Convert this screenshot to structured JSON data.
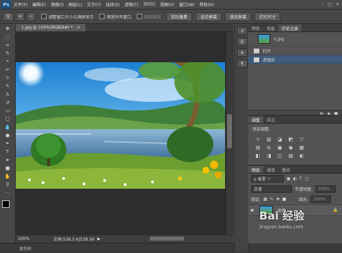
{
  "app": {
    "logo": "Ps"
  },
  "menu": [
    "文件(F)",
    "编辑(E)",
    "图像(I)",
    "图层(L)",
    "文字(Y)",
    "选择(S)",
    "滤镜(T)",
    "3D(D)",
    "视图(V)",
    "窗口(W)",
    "帮助(H)"
  ],
  "window_controls": [
    "–",
    "□",
    "✕"
  ],
  "options": {
    "check1": "调整窗口大小以满屏显示",
    "check2": "缩放所有窗口",
    "check3": "细微缩放",
    "btn_actual": "实际像素",
    "btn_fit": "适合屏幕",
    "btn_fill": "填充屏幕",
    "btn_print": "打印尺寸"
  },
  "document": {
    "tab_label": "1.jpg @ 100%(RGB/8#) *",
    "tab_close": "×"
  },
  "status": {
    "zoom": "100%",
    "doc_info": "文档:538.5 K/538.5K"
  },
  "minibridge": {
    "label": "迷你桥"
  },
  "history_panel": {
    "tabs": [
      "颜色",
      "色板",
      "历史记录"
    ],
    "snapshot_name": "1.jpg",
    "items": [
      "打开",
      "滤镜库"
    ]
  },
  "adjustments_panel": {
    "tabs": [
      "调整",
      "样式"
    ],
    "title": "添加调整",
    "icons": [
      "☼",
      "▥",
      "◪",
      "◩",
      "▽",
      "▤",
      "⚖",
      "▣",
      "◉",
      "▦",
      "◧",
      "◨",
      "◫",
      "▨",
      "◐"
    ]
  },
  "layers_panel": {
    "tabs": [
      "图层",
      "通道",
      "路径"
    ],
    "filter_label": "ρ 类型 ÷",
    "blend_mode": "正常",
    "opacity_label": "不透明度:",
    "opacity_value": "100%",
    "lock_label": "锁定:",
    "fill_label": "填充:",
    "fill_value": "100%",
    "layer_name": "背景"
  },
  "watermark": {
    "brand": "Bai 经验",
    "url": "jingyan.baidu.com"
  },
  "colors": {
    "accent_selection": "#3f5a7a",
    "panel_bg": "#535353",
    "canvas_bg": "#2d2d2d"
  }
}
